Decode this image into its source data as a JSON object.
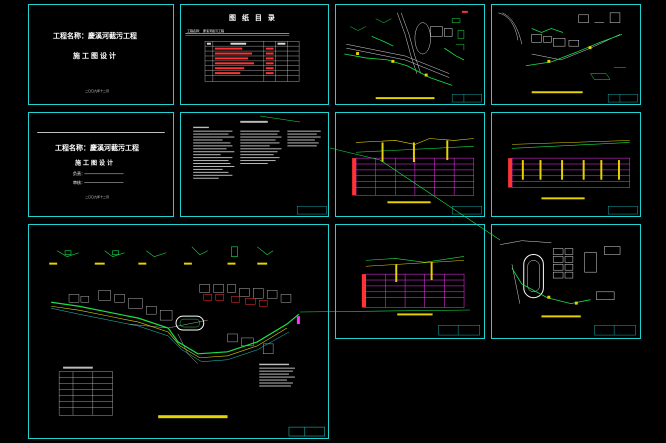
{
  "cover": {
    "project_title": "工程名称：慶溪河截污工程",
    "stage": "施工图设计",
    "date": "二〇〇九年十二月"
  },
  "index_sheet": {
    "title": "图 纸 目 录",
    "project_field": "工程名称：",
    "project_value": "慶溪河截污工程"
  },
  "cover2": {
    "project_title": "工程名称：慶溪河截污工程",
    "stage": "施工图设计",
    "line1_label": "负责：",
    "line2_label": "审核：",
    "date": "二〇〇九年十二月"
  },
  "colors": {
    "frame": "#1fd3d3",
    "background": "#000000",
    "green": "#19e24a",
    "yellow": "#e6d300",
    "magenta": "#ff33ff",
    "red": "#ff3333",
    "white": "#ffffff"
  }
}
